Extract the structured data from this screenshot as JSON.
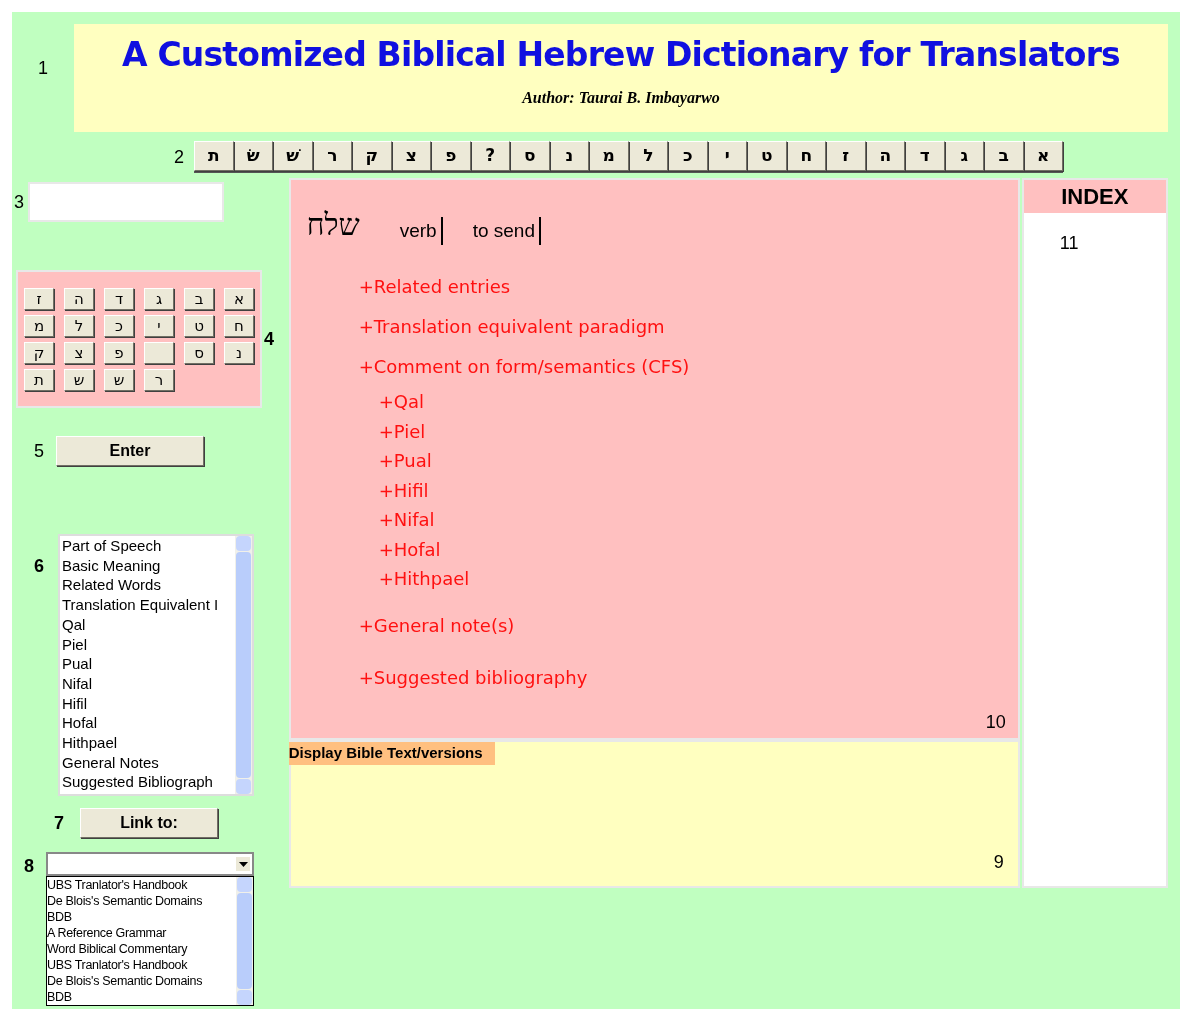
{
  "header": {
    "marker": "1",
    "title": "A Customized Biblical Hebrew Dictionary for Translators",
    "author": "Author: Taurai B. Imbayarwo"
  },
  "alphabet_bar": {
    "marker": "2",
    "letters": [
      "א",
      "ב",
      "ג",
      "ד",
      "ה",
      "ז",
      "ח",
      "ט",
      "י",
      "כ",
      "ל",
      "מ",
      "נ",
      "ס",
      "?",
      "פ",
      "צ",
      "ק",
      "ר",
      "שׁ",
      "שׂ",
      "ת"
    ]
  },
  "search": {
    "marker": "3"
  },
  "keyboard": {
    "marker": "4",
    "rows": [
      [
        {
          "kind": "letter",
          "label": "ז"
        },
        {
          "kind": "letter",
          "label": "ה"
        },
        {
          "kind": "letter",
          "label": "ד"
        },
        {
          "kind": "letter",
          "label": "ג"
        },
        {
          "kind": "letter",
          "label": "ב"
        },
        {
          "kind": "letter",
          "label": "א"
        }
      ],
      [
        {
          "kind": "letter",
          "label": "מ"
        },
        {
          "kind": "letter",
          "label": "ל"
        },
        {
          "kind": "letter",
          "label": "כ"
        },
        {
          "kind": "letter",
          "label": "י"
        },
        {
          "kind": "letter",
          "label": "ט"
        },
        {
          "kind": "letter",
          "label": "ח"
        }
      ],
      [
        {
          "kind": "letter",
          "label": "ק"
        },
        {
          "kind": "letter",
          "label": "צ"
        },
        {
          "kind": "letter",
          "label": "פ"
        },
        {
          "kind": "blank"
        },
        {
          "kind": "letter",
          "label": "ס"
        },
        {
          "kind": "letter",
          "label": "נ"
        }
      ],
      [
        {
          "kind": "letter",
          "label": "ת"
        },
        {
          "kind": "letter",
          "label": "ש"
        },
        {
          "kind": "letter",
          "label": "ש"
        },
        {
          "kind": "letter",
          "label": "ר"
        }
      ]
    ]
  },
  "enter_button": {
    "marker": "5",
    "label": "Enter"
  },
  "sections_list": {
    "marker": "6",
    "items": [
      "Part of Speech",
      "Basic Meaning",
      "Related Words",
      "Translation Equivalent I",
      "Qal",
      "Piel",
      "Pual",
      "Nifal",
      "Hifil",
      "Hofal",
      "Hithpael",
      "General Notes",
      "Suggested Bibliograph"
    ]
  },
  "link_button": {
    "marker": "7",
    "label": "Link to:"
  },
  "resources": {
    "marker": "8",
    "items": [
      "UBS Tranlator's Handbook",
      "De Blois's Semantic Domains",
      "BDB",
      "A Reference Grammar",
      "Word Biblical Commentary",
      "UBS Tranlator's Handbook",
      "De Blois's Semantic Domains",
      "BDB"
    ]
  },
  "entry": {
    "marker": "10",
    "headword": "שלח",
    "part_of_speech": "verb",
    "gloss": "to send",
    "sections": [
      {
        "kind": "heading",
        "label": "+Related entries"
      },
      {
        "kind": "heading",
        "label": "+Translation equivalent paradigm"
      },
      {
        "kind": "heading",
        "label": "+Comment on form/semantics (CFS)"
      },
      {
        "kind": "stem",
        "label": "+Qal"
      },
      {
        "kind": "stem",
        "label": "+Piel"
      },
      {
        "kind": "stem",
        "label": "+Pual"
      },
      {
        "kind": "stem",
        "label": "+Hifil"
      },
      {
        "kind": "stem",
        "label": "+Nifal"
      },
      {
        "kind": "stem",
        "label": "+Hofal"
      },
      {
        "kind": "stem",
        "label": "+Hithpael"
      },
      {
        "kind": "note",
        "label": "+General note(s)"
      },
      {
        "kind": "note",
        "label": "+Suggested bibliography"
      }
    ]
  },
  "bible_text": {
    "marker": "9",
    "title": "Display Bible Text/versions"
  },
  "index": {
    "title": "INDEX",
    "marker": "11"
  }
}
